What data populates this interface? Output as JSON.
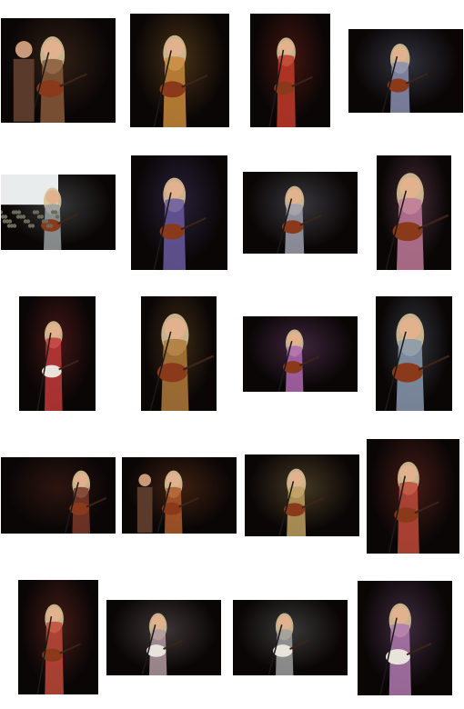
{
  "gallery": {
    "photos": [
      {
        "scene": "band-stage",
        "tone": "#8a5a3a"
      },
      {
        "scene": "guitar-mic",
        "tone": "#c98a3a"
      },
      {
        "scene": "guitar-stand",
        "tone": "#c23a2a"
      },
      {
        "scene": "guitar-mic",
        "tone": "#8a8fb0"
      },
      {
        "scene": "outdoor-crowd",
        "tone": "#9aa0a0"
      },
      {
        "scene": "guitar-mic",
        "tone": "#6a5aa0"
      },
      {
        "scene": "guitar-stand",
        "tone": "#a0a0b0"
      },
      {
        "scene": "close-up",
        "tone": "#c07a9a"
      },
      {
        "scene": "bass-player",
        "tone": "#c23a3a"
      },
      {
        "scene": "close-up",
        "tone": "#b07a3a"
      },
      {
        "scene": "guitar-mic",
        "tone": "#b06ab0"
      },
      {
        "scene": "close-up",
        "tone": "#8a9ab0"
      },
      {
        "scene": "wide-stage",
        "tone": "#7a3a2a"
      },
      {
        "scene": "duo-stage",
        "tone": "#b05a2a"
      },
      {
        "scene": "guitar-mic",
        "tone": "#c0a060"
      },
      {
        "scene": "guitar-mic",
        "tone": "#c04a3a"
      },
      {
        "scene": "guitar-mic",
        "tone": "#c04a3a"
      },
      {
        "scene": "bass-player",
        "tone": "#b09aa0"
      },
      {
        "scene": "bass-player",
        "tone": "#a0a0a0"
      },
      {
        "scene": "bass-player",
        "tone": "#b07ab0"
      }
    ]
  }
}
